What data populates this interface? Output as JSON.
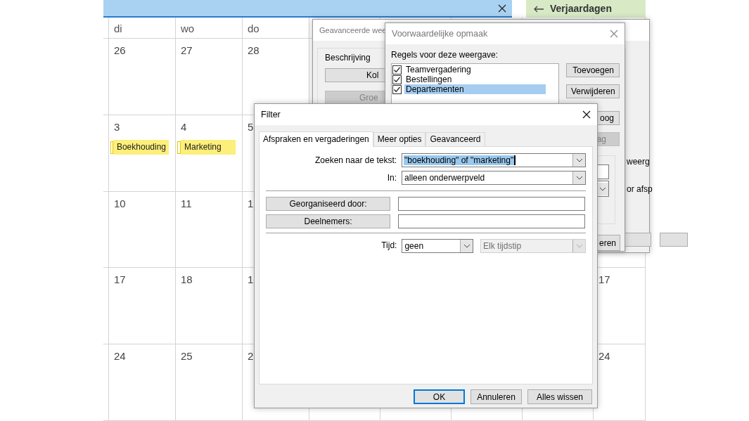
{
  "calendar": {
    "side_panel": {
      "title": "Verjaardagen"
    },
    "weekdays": [
      "di",
      "wo",
      "do"
    ],
    "weeks": [
      {
        "days": [
          {
            "date": "26"
          },
          {
            "date": "27"
          },
          {
            "date": "28"
          }
        ]
      },
      {
        "days": [
          {
            "date": "3",
            "events": [
              {
                "title": "Boekhouding"
              }
            ]
          },
          {
            "date": "4",
            "events": [
              {
                "title": "Marketing"
              }
            ]
          },
          {
            "date": "5"
          }
        ]
      },
      {
        "days": [
          {
            "date": "10"
          },
          {
            "date": "11"
          },
          {
            "date": "1"
          }
        ]
      },
      {
        "days": [
          {
            "date": "17"
          },
          {
            "date": "18"
          },
          {
            "date": "1"
          }
        ],
        "last_column": {
          "date": "17"
        }
      },
      {
        "days": [
          {
            "date": "24"
          },
          {
            "date": "25"
          },
          {
            "date": "2"
          }
        ],
        "last_column": {
          "date": "24"
        }
      }
    ]
  },
  "advanced_view_dialog": {
    "title": "Geavanceerde wee",
    "group_label": "Beschrijving",
    "buttons": [
      {
        "label": "Kol",
        "disabled": false
      },
      {
        "label": "Groe",
        "disabled": true
      }
    ],
    "side_texts": [
      "weerg",
      "or afsp"
    ]
  },
  "conditional_format_dialog": {
    "title": "Voorwaardelijke opmaak",
    "rules_label": "Regels voor deze weergave:",
    "rules": [
      {
        "label": "Teamvergadering",
        "checked": true,
        "selected": false
      },
      {
        "label": "Bestellingen",
        "checked": true,
        "selected": false
      },
      {
        "label": "Departementen",
        "checked": true,
        "selected": true
      }
    ],
    "buttons": [
      {
        "label": "Toevoegen",
        "disabled": false
      },
      {
        "label": "Verwijderen",
        "disabled": false
      },
      {
        "label": "oog",
        "disabled": false
      },
      {
        "label": "ag",
        "disabled": true
      }
    ],
    "footer_button": "eren"
  },
  "filter_dialog": {
    "title": "Filter",
    "tabs": [
      {
        "label": "Afspraken en vergaderingen",
        "selected": true
      },
      {
        "label": "Meer opties",
        "selected": false
      },
      {
        "label": "Geavanceerd",
        "selected": false
      }
    ],
    "search_text": {
      "label": "Zoeken naar de tekst:",
      "value": "\"boekhouding\" of \"marketing\"",
      "highlighted": true
    },
    "search_in": {
      "label": "In:",
      "value": "alleen onderwerpveld"
    },
    "people": [
      {
        "button": "Georganiseerd door:"
      },
      {
        "button": "Deelnemers:"
      }
    ],
    "time": {
      "label": "Tijd:",
      "value": "geen",
      "range": {
        "value": "Elk tijdstip",
        "disabled": true
      }
    },
    "buttons": [
      {
        "label": "OK",
        "default": true
      },
      {
        "label": "Annuleren",
        "default": false
      },
      {
        "label": "Alles wissen",
        "default": false
      }
    ]
  }
}
